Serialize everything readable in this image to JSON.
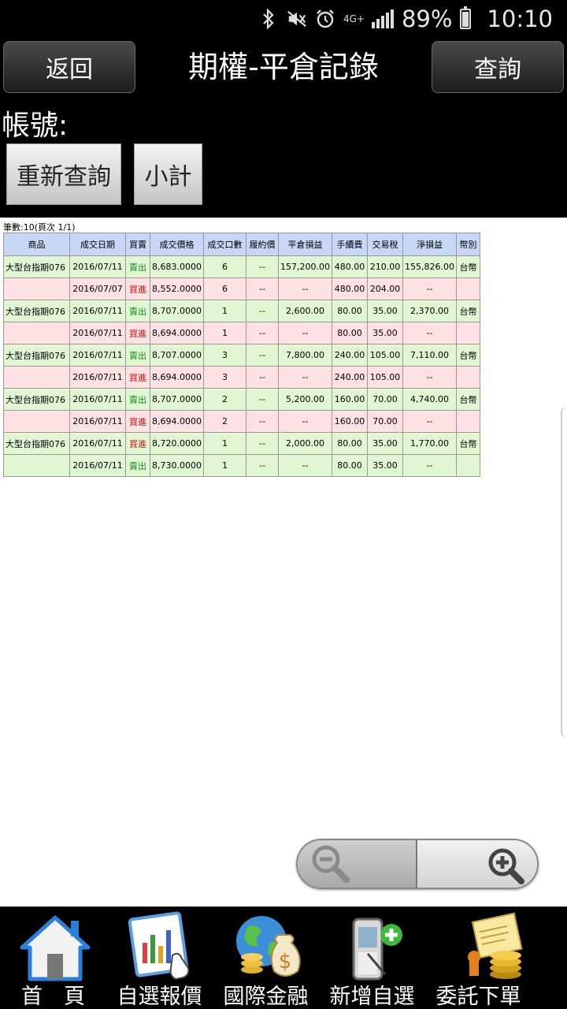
{
  "status_bar": {
    "network": "4G+",
    "battery": "89%",
    "time": "10:10"
  },
  "header": {
    "back_label": "返回",
    "title": "期權-平倉記錄",
    "query_label": "查詢",
    "account_label": "帳號:",
    "requery_label": "重新查詢",
    "subtotal_label": "小計"
  },
  "table": {
    "record_count": "筆數:10(頁次 1/1)",
    "headers": [
      "商品",
      "成交日期",
      "買賣",
      "成交價格",
      "成交口數",
      "履約價",
      "平倉損益",
      "手續費",
      "交易稅",
      "淨損益",
      "幣別"
    ],
    "rows": [
      [
        "大型台指期076",
        "2016/07/11",
        "賣出",
        "8,683.0000",
        "6",
        "--",
        "157,200.00",
        "480.00",
        "210.00",
        "155,826.00",
        "台幣"
      ],
      [
        "",
        "2016/07/07",
        "買進",
        "8,552.0000",
        "6",
        "--",
        "--",
        "480.00",
        "204.00",
        "--",
        ""
      ],
      [
        "大型台指期076",
        "2016/07/11",
        "賣出",
        "8,707.0000",
        "1",
        "--",
        "2,600.00",
        "80.00",
        "35.00",
        "2,370.00",
        "台幣"
      ],
      [
        "",
        "2016/07/11",
        "買進",
        "8,694.0000",
        "1",
        "--",
        "--",
        "80.00",
        "35.00",
        "--",
        ""
      ],
      [
        "大型台指期076",
        "2016/07/11",
        "賣出",
        "8,707.0000",
        "3",
        "--",
        "7,800.00",
        "240.00",
        "105.00",
        "7,110.00",
        "台幣"
      ],
      [
        "",
        "2016/07/11",
        "買進",
        "8,694.0000",
        "3",
        "--",
        "--",
        "240.00",
        "105.00",
        "--",
        ""
      ],
      [
        "大型台指期076",
        "2016/07/11",
        "賣出",
        "8,707.0000",
        "2",
        "--",
        "5,200.00",
        "160.00",
        "70.00",
        "4,740.00",
        "台幣"
      ],
      [
        "",
        "2016/07/11",
        "買進",
        "8,694.0000",
        "2",
        "--",
        "--",
        "160.00",
        "70.00",
        "--",
        ""
      ],
      [
        "大型台指期076",
        "2016/07/11",
        "買進",
        "8,720.0000",
        "1",
        "--",
        "2,000.00",
        "80.00",
        "35.00",
        "1,770.00",
        "台幣"
      ],
      [
        "",
        "2016/07/11",
        "賣出",
        "8,730.0000",
        "1",
        "--",
        "--",
        "80.00",
        "35.00",
        "--",
        ""
      ]
    ],
    "row_colors": [
      "green",
      "pink",
      "green",
      "pink",
      "green",
      "pink",
      "green",
      "pink",
      "green",
      "green"
    ],
    "colors": {
      "header_bg": "#c7d7f5",
      "green_row": "#e1f7d4",
      "pink_row": "#fde1e3",
      "sell_text": "#1a8a1a",
      "buy_text": "#d01010"
    }
  },
  "zoom": {
    "out_icon": "zoom-out-icon",
    "in_icon": "zoom-in-icon"
  },
  "bottom_nav": [
    {
      "label": "首　頁",
      "icon": "home-icon"
    },
    {
      "label": "自選報價",
      "icon": "chart-quote-icon"
    },
    {
      "label": "國際金融",
      "icon": "globe-money-icon"
    },
    {
      "label": "新增自選",
      "icon": "phone-add-icon"
    },
    {
      "label": "委託下單",
      "icon": "coins-order-icon"
    }
  ]
}
